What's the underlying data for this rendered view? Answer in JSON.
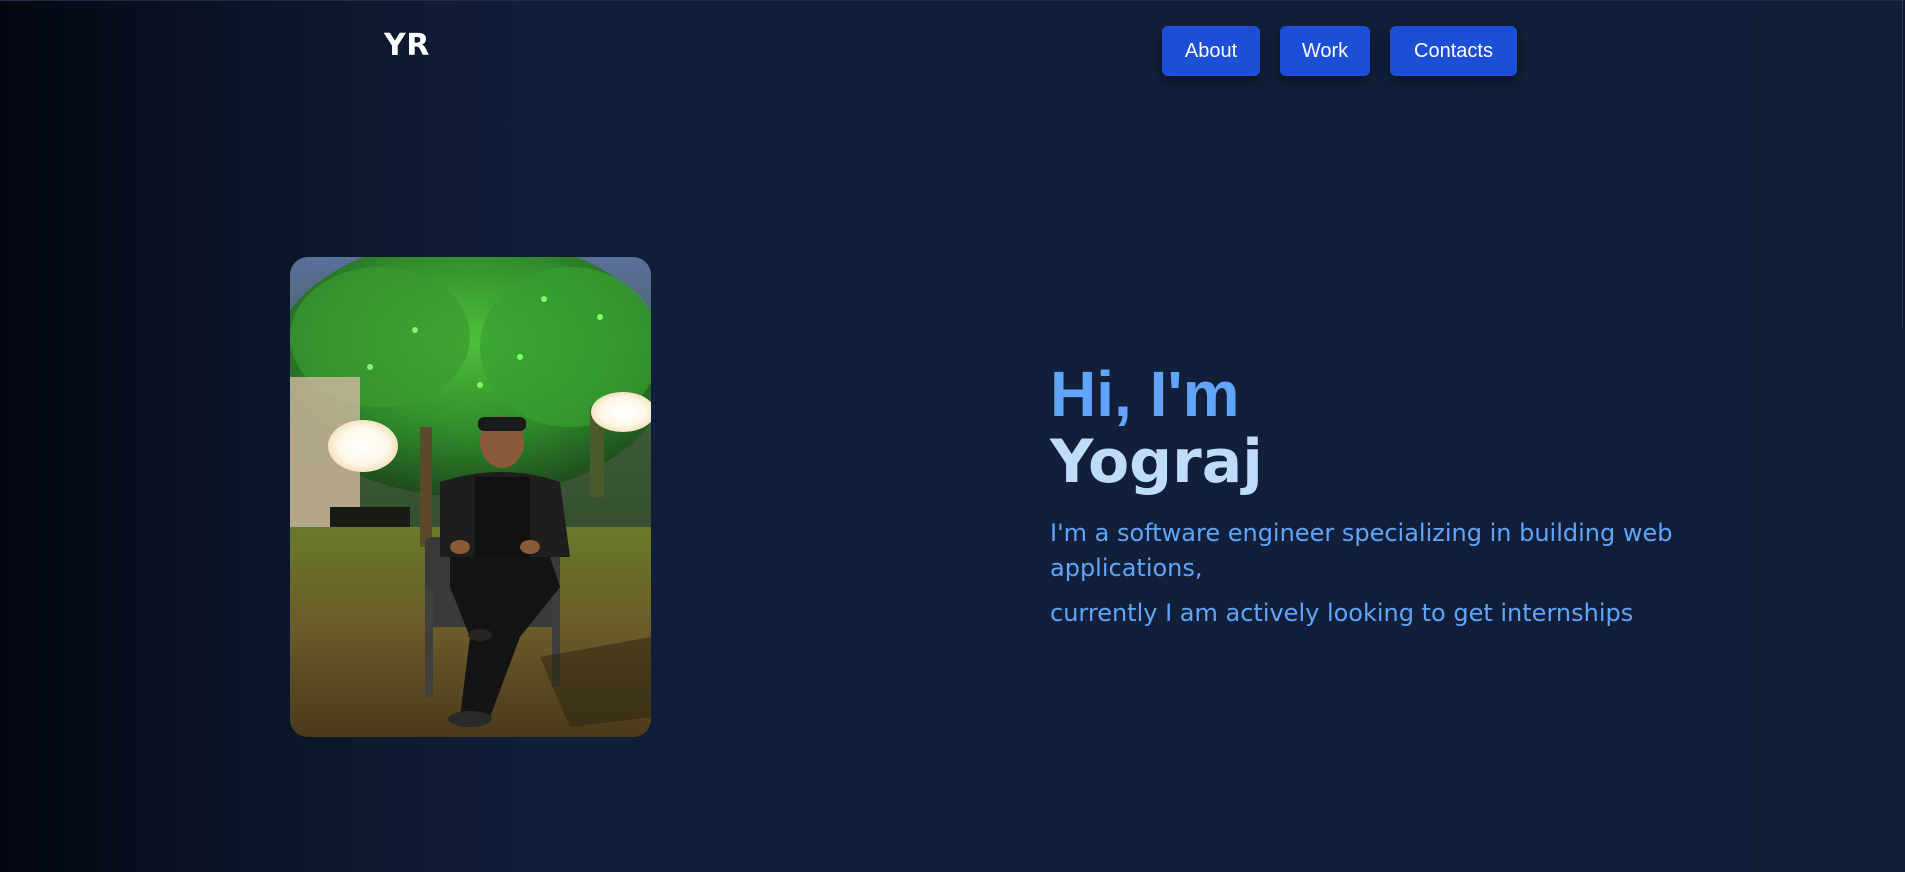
{
  "header": {
    "logo": "YR",
    "nav": [
      {
        "label": "About"
      },
      {
        "label": "Work"
      },
      {
        "label": "Contacts"
      }
    ]
  },
  "hero": {
    "greeting": "Hi, I'm",
    "name": "Yograj",
    "description_line1": "I'm a software engineer specializing in building web applications,",
    "description_line2": "currently I am actively looking to get internships"
  },
  "colors": {
    "accent": "#1d4ed8",
    "greeting": "#60a5fa",
    "name": "#bfdbfe",
    "background": "#111e3a"
  },
  "icons": {
    "profile_photo": "profile-photo-image"
  }
}
